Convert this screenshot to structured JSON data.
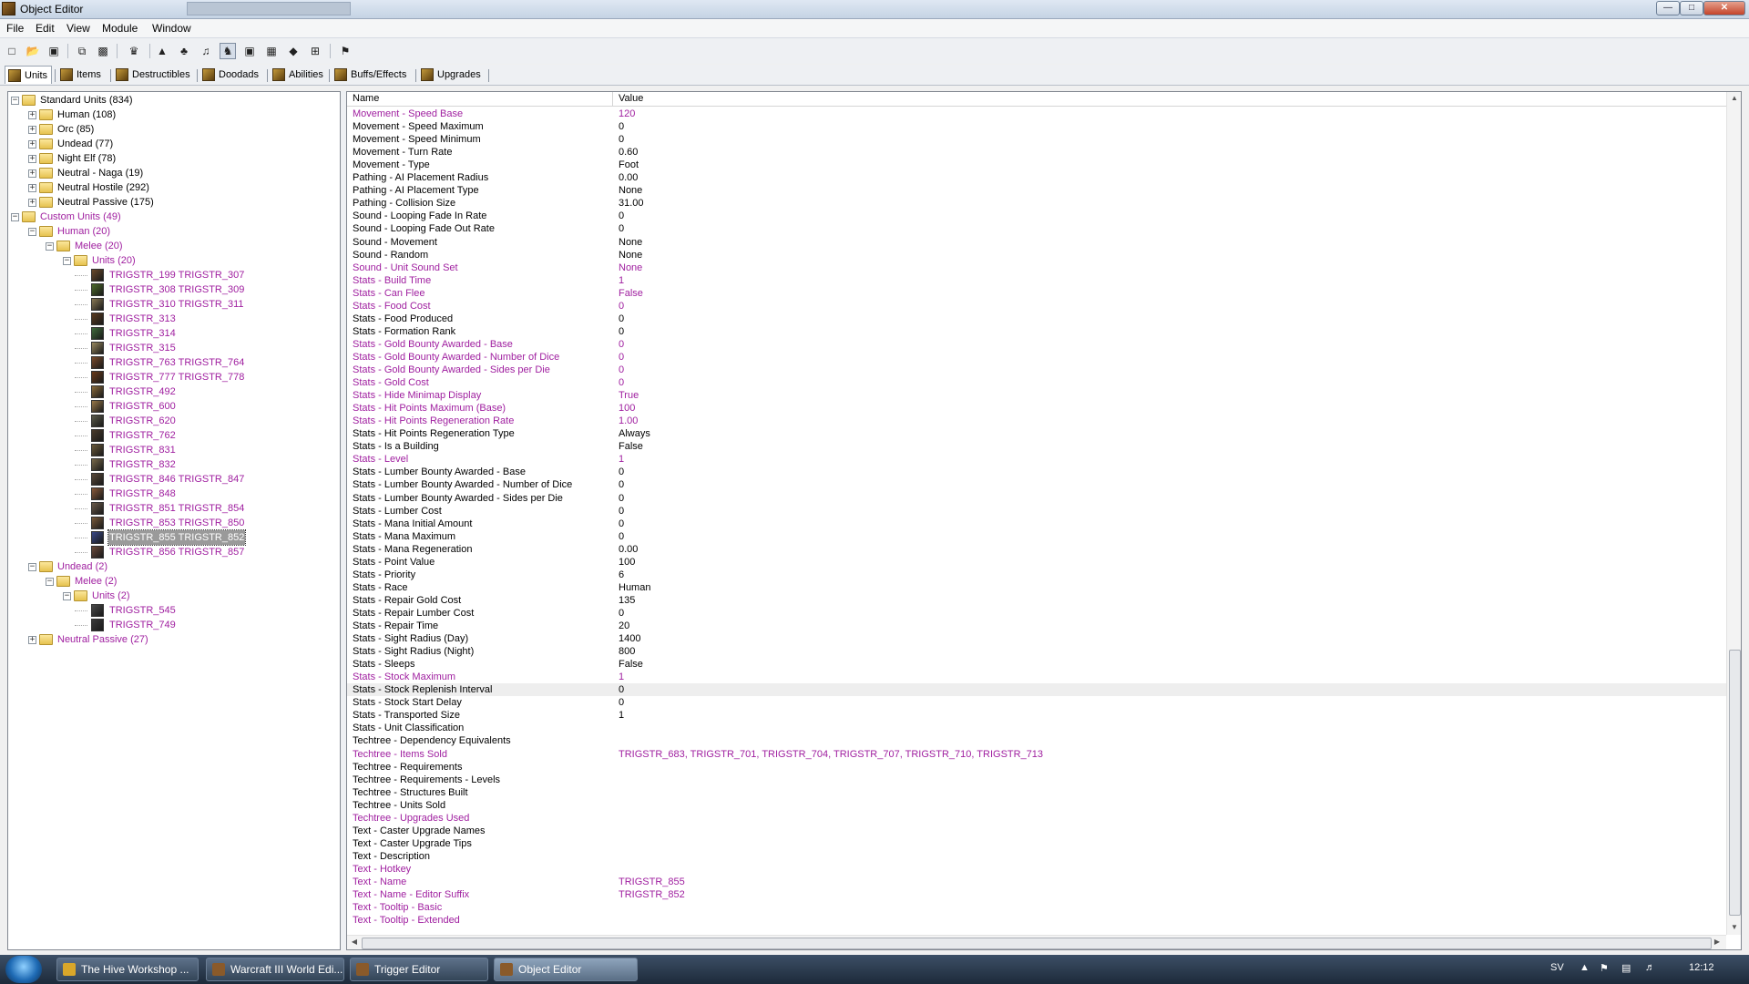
{
  "window": {
    "title": "Object Editor"
  },
  "menu": [
    "File",
    "Edit",
    "View",
    "Module",
    "Window"
  ],
  "toolbar_icons": [
    "new-icon",
    "open-icon",
    "save-icon",
    "copy-icon",
    "paste-icon",
    "unit-icon",
    "terrain-icon",
    "doodad-icon",
    "sound-icon",
    "unit-palette-icon",
    "camera-icon",
    "region-icon",
    "object-icon",
    "import-icon",
    "trigger-icon"
  ],
  "tabs": [
    "Units",
    "Items",
    "Destructibles",
    "Doodads",
    "Abilities",
    "Buffs/Effects",
    "Upgrades"
  ],
  "tree": [
    {
      "label": "Standard Units (834)",
      "depth": 0,
      "kind": "folder",
      "custom": false,
      "exp": "-"
    },
    {
      "label": "Human (108)",
      "depth": 1,
      "kind": "folder",
      "custom": false,
      "exp": "+"
    },
    {
      "label": "Orc (85)",
      "depth": 1,
      "kind": "folder",
      "custom": false,
      "exp": "+"
    },
    {
      "label": "Undead (77)",
      "depth": 1,
      "kind": "folder",
      "custom": false,
      "exp": "+"
    },
    {
      "label": "Night Elf (78)",
      "depth": 1,
      "kind": "folder",
      "custom": false,
      "exp": "+"
    },
    {
      "label": "Neutral - Naga (19)",
      "depth": 1,
      "kind": "folder",
      "custom": false,
      "exp": "+"
    },
    {
      "label": "Neutral Hostile (292)",
      "depth": 1,
      "kind": "folder",
      "custom": false,
      "exp": "+"
    },
    {
      "label": "Neutral Passive (175)",
      "depth": 1,
      "kind": "folder",
      "custom": false,
      "exp": "+"
    },
    {
      "label": "Custom Units (49)",
      "depth": 0,
      "kind": "folder",
      "custom": true,
      "exp": "-"
    },
    {
      "label": "Human (20)",
      "depth": 1,
      "kind": "folder",
      "custom": true,
      "exp": "-"
    },
    {
      "label": "Melee (20)",
      "depth": 2,
      "kind": "folder",
      "custom": true,
      "exp": "-"
    },
    {
      "label": "Units (20)",
      "depth": 3,
      "kind": "folder",
      "custom": true,
      "exp": "-"
    },
    {
      "label": "TRIGSTR_199 TRIGSTR_307",
      "depth": 4,
      "kind": "unit",
      "custom": true,
      "color": "#6b4a2a"
    },
    {
      "label": "TRIGSTR_308 TRIGSTR_309",
      "depth": 4,
      "kind": "unit",
      "custom": true,
      "color": "#4d6b2a"
    },
    {
      "label": "TRIGSTR_310 TRIGSTR_311",
      "depth": 4,
      "kind": "unit",
      "custom": true,
      "color": "#8a7a55"
    },
    {
      "label": "TRIGSTR_313",
      "depth": 4,
      "kind": "unit",
      "custom": true,
      "color": "#5a3a20"
    },
    {
      "label": "TRIGSTR_314",
      "depth": 4,
      "kind": "unit",
      "custom": true,
      "color": "#3f6a3a"
    },
    {
      "label": "TRIGSTR_315",
      "depth": 4,
      "kind": "unit",
      "custom": true,
      "color": "#9a8a60"
    },
    {
      "label": "TRIGSTR_763 TRIGSTR_764",
      "depth": 4,
      "kind": "unit",
      "custom": true,
      "color": "#7a4a2a"
    },
    {
      "label": "TRIGSTR_777 TRIGSTR_778",
      "depth": 4,
      "kind": "unit",
      "custom": true,
      "color": "#6a3a1a"
    },
    {
      "label": "TRIGSTR_492",
      "depth": 4,
      "kind": "unit",
      "custom": true,
      "color": "#8a6a3a"
    },
    {
      "label": "TRIGSTR_600",
      "depth": 4,
      "kind": "unit",
      "custom": true,
      "color": "#9a7a4a"
    },
    {
      "label": "TRIGSTR_620",
      "depth": 4,
      "kind": "unit",
      "custom": true,
      "color": "#5a5a4a"
    },
    {
      "label": "TRIGSTR_762",
      "depth": 4,
      "kind": "unit",
      "custom": true,
      "color": "#4a3a2a"
    },
    {
      "label": "TRIGSTR_831",
      "depth": 4,
      "kind": "unit",
      "custom": true,
      "color": "#6a5a3a"
    },
    {
      "label": "TRIGSTR_832",
      "depth": 4,
      "kind": "unit",
      "custom": true,
      "color": "#7a6a4a"
    },
    {
      "label": "TRIGSTR_846 TRIGSTR_847",
      "depth": 4,
      "kind": "unit",
      "custom": true,
      "color": "#5a4a3a"
    },
    {
      "label": "TRIGSTR_848",
      "depth": 4,
      "kind": "unit",
      "custom": true,
      "color": "#8a5a3a"
    },
    {
      "label": "TRIGSTR_851 TRIGSTR_854",
      "depth": 4,
      "kind": "unit",
      "custom": true,
      "color": "#6a5a4a"
    },
    {
      "label": "TRIGSTR_853 TRIGSTR_850",
      "depth": 4,
      "kind": "unit",
      "custom": true,
      "color": "#7a5a3a"
    },
    {
      "label": "TRIGSTR_855 TRIGSTR_852",
      "depth": 4,
      "kind": "unit",
      "custom": true,
      "color": "#3a4a8a",
      "selected": true
    },
    {
      "label": "TRIGSTR_856 TRIGSTR_857",
      "depth": 4,
      "kind": "unit",
      "custom": true,
      "color": "#6a4a3a"
    },
    {
      "label": "Undead (2)",
      "depth": 1,
      "kind": "folder",
      "custom": true,
      "exp": "-"
    },
    {
      "label": "Melee (2)",
      "depth": 2,
      "kind": "folder",
      "custom": true,
      "exp": "-"
    },
    {
      "label": "Units (2)",
      "depth": 3,
      "kind": "folder",
      "custom": true,
      "exp": "-"
    },
    {
      "label": "TRIGSTR_545",
      "depth": 4,
      "kind": "unit",
      "custom": true,
      "color": "#4a4a4a"
    },
    {
      "label": "TRIGSTR_749",
      "depth": 4,
      "kind": "unit",
      "custom": true,
      "color": "#3a3a3a"
    },
    {
      "label": "Neutral Passive (27)",
      "depth": 1,
      "kind": "folder",
      "custom": true,
      "exp": "+"
    }
  ],
  "grid": {
    "col_name": "Name",
    "col_value": "Value",
    "rows": [
      {
        "n": "Movement - Speed Base",
        "v": "120",
        "c": true
      },
      {
        "n": "Movement - Speed Maximum",
        "v": "0",
        "c": false
      },
      {
        "n": "Movement - Speed Minimum",
        "v": "0",
        "c": false
      },
      {
        "n": "Movement - Turn Rate",
        "v": "0.60",
        "c": false
      },
      {
        "n": "Movement - Type",
        "v": "Foot",
        "c": false
      },
      {
        "n": "Pathing - AI Placement Radius",
        "v": "0.00",
        "c": false
      },
      {
        "n": "Pathing - AI Placement Type",
        "v": "None",
        "c": false
      },
      {
        "n": "Pathing - Collision Size",
        "v": "31.00",
        "c": false
      },
      {
        "n": "Sound - Looping Fade In Rate",
        "v": "0",
        "c": false
      },
      {
        "n": "Sound - Looping Fade Out Rate",
        "v": "0",
        "c": false
      },
      {
        "n": "Sound - Movement",
        "v": "None",
        "c": false
      },
      {
        "n": "Sound - Random",
        "v": "None",
        "c": false
      },
      {
        "n": "Sound - Unit Sound Set",
        "v": "None",
        "c": true
      },
      {
        "n": "Stats - Build Time",
        "v": "1",
        "c": true
      },
      {
        "n": "Stats - Can Flee",
        "v": "False",
        "c": true
      },
      {
        "n": "Stats - Food Cost",
        "v": "0",
        "c": true
      },
      {
        "n": "Stats - Food Produced",
        "v": "0",
        "c": false
      },
      {
        "n": "Stats - Formation Rank",
        "v": "0",
        "c": false
      },
      {
        "n": "Stats - Gold Bounty Awarded - Base",
        "v": "0",
        "c": true
      },
      {
        "n": "Stats - Gold Bounty Awarded - Number of Dice",
        "v": "0",
        "c": true
      },
      {
        "n": "Stats - Gold Bounty Awarded - Sides per Die",
        "v": "0",
        "c": true
      },
      {
        "n": "Stats - Gold Cost",
        "v": "0",
        "c": true
      },
      {
        "n": "Stats - Hide Minimap Display",
        "v": "True",
        "c": true
      },
      {
        "n": "Stats - Hit Points Maximum (Base)",
        "v": "100",
        "c": true
      },
      {
        "n": "Stats - Hit Points Regeneration Rate",
        "v": "1.00",
        "c": true
      },
      {
        "n": "Stats - Hit Points Regeneration Type",
        "v": "Always",
        "c": false
      },
      {
        "n": "Stats - Is a Building",
        "v": "False",
        "c": false
      },
      {
        "n": "Stats - Level",
        "v": "1",
        "c": true
      },
      {
        "n": "Stats - Lumber Bounty Awarded - Base",
        "v": "0",
        "c": false
      },
      {
        "n": "Stats - Lumber Bounty Awarded - Number of Dice",
        "v": "0",
        "c": false
      },
      {
        "n": "Stats - Lumber Bounty Awarded - Sides per Die",
        "v": "0",
        "c": false
      },
      {
        "n": "Stats - Lumber Cost",
        "v": "0",
        "c": false
      },
      {
        "n": "Stats - Mana Initial Amount",
        "v": "0",
        "c": false
      },
      {
        "n": "Stats - Mana Maximum",
        "v": "0",
        "c": false
      },
      {
        "n": "Stats - Mana Regeneration",
        "v": "0.00",
        "c": false
      },
      {
        "n": "Stats - Point Value",
        "v": "100",
        "c": false
      },
      {
        "n": "Stats - Priority",
        "v": "6",
        "c": false
      },
      {
        "n": "Stats - Race",
        "v": "Human",
        "c": false
      },
      {
        "n": "Stats - Repair Gold Cost",
        "v": "135",
        "c": false
      },
      {
        "n": "Stats - Repair Lumber Cost",
        "v": "0",
        "c": false
      },
      {
        "n": "Stats - Repair Time",
        "v": "20",
        "c": false
      },
      {
        "n": "Stats - Sight Radius (Day)",
        "v": "1400",
        "c": false
      },
      {
        "n": "Stats - Sight Radius (Night)",
        "v": "800",
        "c": false
      },
      {
        "n": "Stats - Sleeps",
        "v": "False",
        "c": false
      },
      {
        "n": "Stats - Stock Maximum",
        "v": "1",
        "c": true
      },
      {
        "n": "Stats - Stock Replenish Interval",
        "v": "0",
        "c": false,
        "hl": true
      },
      {
        "n": "Stats - Stock Start Delay",
        "v": "0",
        "c": false
      },
      {
        "n": "Stats - Transported Size",
        "v": "1",
        "c": false
      },
      {
        "n": "Stats - Unit Classification",
        "v": "",
        "c": false
      },
      {
        "n": "Techtree - Dependency Equivalents",
        "v": "",
        "c": false
      },
      {
        "n": "Techtree - Items Sold",
        "v": "TRIGSTR_683, TRIGSTR_701, TRIGSTR_704, TRIGSTR_707, TRIGSTR_710, TRIGSTR_713",
        "c": true
      },
      {
        "n": "Techtree - Requirements",
        "v": "",
        "c": false
      },
      {
        "n": "Techtree - Requirements - Levels",
        "v": "",
        "c": false
      },
      {
        "n": "Techtree - Structures Built",
        "v": "",
        "c": false
      },
      {
        "n": "Techtree - Units Sold",
        "v": "",
        "c": false
      },
      {
        "n": "Techtree - Upgrades Used",
        "v": "",
        "c": true
      },
      {
        "n": "Text - Caster Upgrade Names",
        "v": "",
        "c": false
      },
      {
        "n": "Text - Caster Upgrade Tips",
        "v": "",
        "c": false
      },
      {
        "n": "Text - Description",
        "v": "",
        "c": false
      },
      {
        "n": "Text - Hotkey",
        "v": "",
        "c": true
      },
      {
        "n": "Text - Name",
        "v": "TRIGSTR_855",
        "c": true
      },
      {
        "n": "Text - Name - Editor Suffix",
        "v": "TRIGSTR_852",
        "c": true
      },
      {
        "n": "Text - Tooltip - Basic",
        "v": "",
        "c": true
      },
      {
        "n": "Text - Tooltip - Extended",
        "v": "",
        "c": true
      }
    ]
  },
  "taskbar": {
    "tasks": [
      {
        "label": "The Hive Workshop ...",
        "color": "#d9a72a",
        "active": false
      },
      {
        "label": "Warcraft III World Edi...",
        "color": "#8a5a2a",
        "active": false
      },
      {
        "label": "Trigger Editor",
        "color": "#8a5a2a",
        "active": false
      },
      {
        "label": "Object Editor",
        "color": "#8a5a2a",
        "active": true
      }
    ],
    "lang": "SV",
    "clock": "12:12"
  },
  "colors": {
    "custom_text": "#a020a0",
    "selection": "#9a9a9a"
  }
}
